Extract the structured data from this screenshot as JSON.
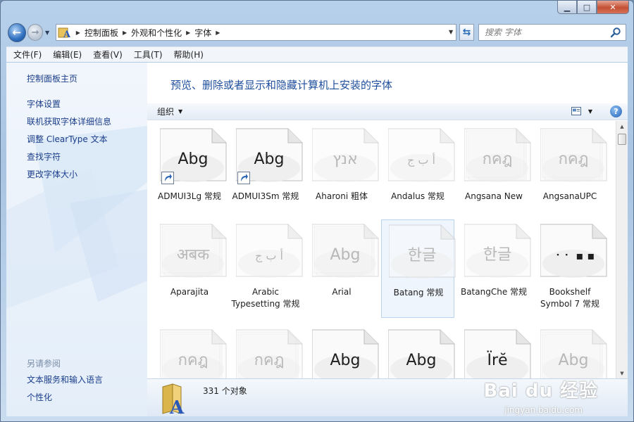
{
  "window": {
    "caption_buttons": [
      "minimize",
      "maximize",
      "close"
    ]
  },
  "nav": {
    "breadcrumb": [
      "控制面板",
      "外观和个性化",
      "字体"
    ],
    "search_placeholder": "搜索 字体"
  },
  "menu": [
    "文件(F)",
    "编辑(E)",
    "查看(V)",
    "工具(T)",
    "帮助(H)"
  ],
  "sidebar": {
    "home": "控制面板主页",
    "tasks": [
      "字体设置",
      "联机获取字体详细信息",
      "调整 ClearType 文本",
      "查找字符",
      "更改字体大小"
    ],
    "see_also_title": "另请参阅",
    "see_also": [
      "文本服务和输入语言",
      "个性化"
    ]
  },
  "main": {
    "heading": "预览、删除或者显示和隐藏计算机上安装的字体",
    "organize_label": "组织",
    "item_count": "331 个对象"
  },
  "fonts": [
    {
      "label": "ADMUI3Lg 常规",
      "sample": "Abg",
      "shortcut": true,
      "faded": false,
      "stack": false
    },
    {
      "label": "ADMUI3Sm 常规",
      "sample": "Abg",
      "shortcut": true,
      "faded": false,
      "stack": false
    },
    {
      "label": "Aharoni 粗体",
      "sample": "אנץ",
      "shortcut": false,
      "faded": true,
      "stack": false
    },
    {
      "label": "Andalus 常规",
      "sample": "أ ب ج",
      "shortcut": false,
      "faded": true,
      "stack": false
    },
    {
      "label": "Angsana New",
      "sample": "กคฎ",
      "shortcut": false,
      "faded": true,
      "stack": true
    },
    {
      "label": "AngsanaUPC",
      "sample": "กคฎ",
      "shortcut": false,
      "faded": true,
      "stack": true
    },
    {
      "label": "Aparajita",
      "sample": "अबक",
      "shortcut": false,
      "faded": true,
      "stack": true
    },
    {
      "label": "Arabic Typesetting 常规",
      "sample": "أ ب ج",
      "shortcut": false,
      "faded": true,
      "stack": false
    },
    {
      "label": "Arial",
      "sample": "Abg",
      "shortcut": false,
      "faded": true,
      "stack": true
    },
    {
      "label": "Batang 常规",
      "sample": "한글",
      "shortcut": false,
      "faded": true,
      "stack": false,
      "selected": true
    },
    {
      "label": "BatangChe 常规",
      "sample": "한글",
      "shortcut": false,
      "faded": true,
      "stack": false
    },
    {
      "label": "Bookshelf Symbol 7 常规",
      "sample": "⠐ ⠂ ▪ ▪",
      "shortcut": false,
      "faded": false,
      "stack": false
    },
    {
      "label": "",
      "sample": "กคฎ",
      "shortcut": false,
      "faded": true,
      "stack": true
    },
    {
      "label": "",
      "sample": "กคฎ",
      "shortcut": false,
      "faded": true,
      "stack": true
    },
    {
      "label": "",
      "sample": "Abg",
      "shortcut": false,
      "faded": false,
      "stack": true
    },
    {
      "label": "",
      "sample": "Abg",
      "shortcut": false,
      "faded": false,
      "stack": true
    },
    {
      "label": "",
      "sample": "Ïrĕ",
      "shortcut": false,
      "faded": false,
      "stack": false
    },
    {
      "label": "",
      "sample": "Abg",
      "shortcut": false,
      "faded": true,
      "stack": true
    }
  ],
  "watermark": {
    "logo": "Bai du 经验",
    "url": "jingyan.baidu.com"
  },
  "colors": {
    "accent_link": "#1b3e8a",
    "heading": "#1e4e9c",
    "close_button": "#c44f33"
  }
}
